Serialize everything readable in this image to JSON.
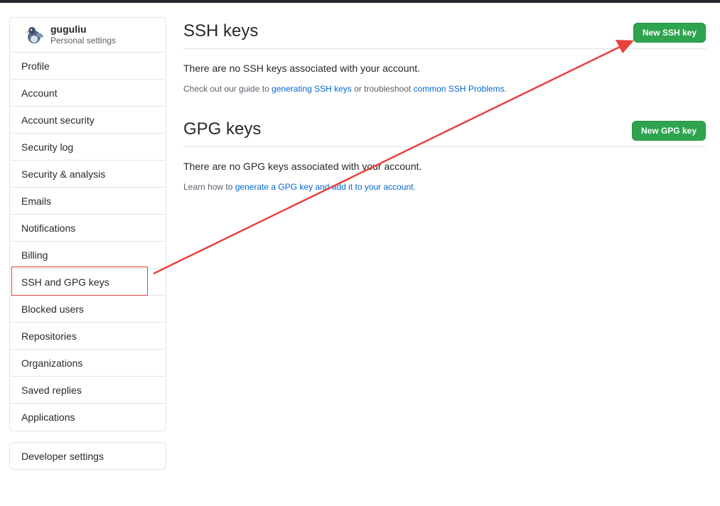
{
  "user": {
    "name": "guguliu",
    "subtitle": "Personal settings"
  },
  "sidebar": {
    "items": [
      {
        "label": "Profile"
      },
      {
        "label": "Account"
      },
      {
        "label": "Account security"
      },
      {
        "label": "Security log"
      },
      {
        "label": "Security & analysis"
      },
      {
        "label": "Emails"
      },
      {
        "label": "Notifications"
      },
      {
        "label": "Billing"
      },
      {
        "label": "SSH and GPG keys"
      },
      {
        "label": "Blocked users"
      },
      {
        "label": "Repositories"
      },
      {
        "label": "Organizations"
      },
      {
        "label": "Saved replies"
      },
      {
        "label": "Applications"
      }
    ],
    "developer_settings": "Developer settings"
  },
  "ssh": {
    "title": "SSH keys",
    "button": "New SSH key",
    "empty": "There are no SSH keys associated with your account.",
    "help_prefix": "Check out our guide to ",
    "help_link1": "generating SSH keys",
    "help_middle": " or troubleshoot ",
    "help_link2": "common SSH Problems",
    "help_suffix": "."
  },
  "gpg": {
    "title": "GPG keys",
    "button": "New GPG key",
    "empty": "There are no GPG keys associated with your account.",
    "help_prefix": "Learn how to ",
    "help_link": "generate a GPG key and add it to your account",
    "help_suffix": "."
  },
  "colors": {
    "accent_green": "#2ea44f",
    "link_blue": "#0366d6",
    "annotation_red": "#e8413c"
  }
}
